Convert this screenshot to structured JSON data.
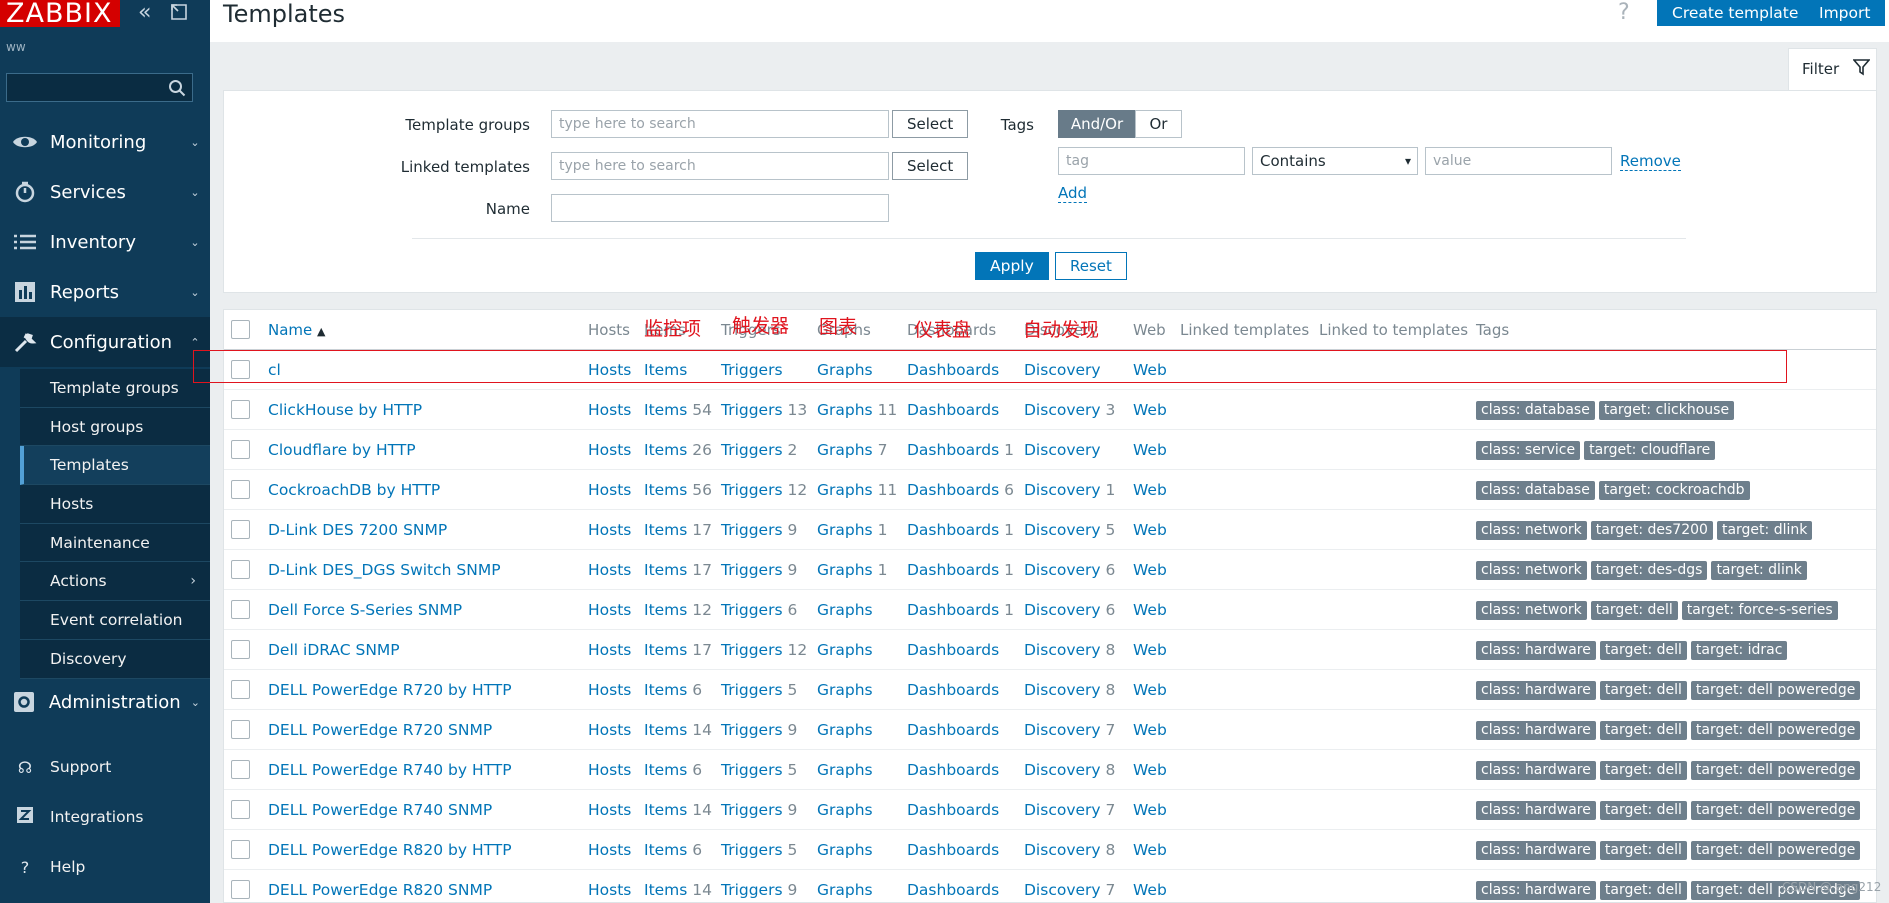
{
  "app": {
    "logo": "ZABBIX",
    "user": "ww"
  },
  "sidebar": {
    "main": [
      {
        "label": "Monitoring"
      },
      {
        "label": "Services"
      },
      {
        "label": "Inventory"
      },
      {
        "label": "Reports"
      },
      {
        "label": "Configuration"
      }
    ],
    "config_items": [
      {
        "label": "Template groups"
      },
      {
        "label": "Host groups"
      },
      {
        "label": "Templates"
      },
      {
        "label": "Hosts"
      },
      {
        "label": "Maintenance"
      },
      {
        "label": "Actions"
      },
      {
        "label": "Event correlation"
      },
      {
        "label": "Discovery"
      }
    ],
    "administration": "Administration",
    "bottom": [
      {
        "label": "Support"
      },
      {
        "label": "Integrations"
      },
      {
        "label": "Help"
      }
    ]
  },
  "header": {
    "title": "Templates",
    "help": "?",
    "create_button": "Create template",
    "import_button": "Import"
  },
  "filter": {
    "tab_label": "Filter",
    "template_groups_label": "Template groups",
    "template_groups_placeholder": "type here to search",
    "linked_templates_label": "Linked templates",
    "linked_templates_placeholder": "type here to search",
    "select_label": "Select",
    "name_label": "Name",
    "name_value": "",
    "tags_label": "Tags",
    "andor_label": "And/Or",
    "or_label": "Or",
    "tag_placeholder": "tag",
    "operator": "Contains",
    "value_placeholder": "value",
    "remove_label": "Remove",
    "add_label": "Add",
    "apply_label": "Apply",
    "reset_label": "Reset"
  },
  "table": {
    "headers": {
      "name": "Name",
      "sort_indicator": "▲",
      "hosts": "Hosts",
      "items": "Items",
      "triggers": "Triggers",
      "graphs": "Graphs",
      "dashboards": "Dashboards",
      "discovery": "Discovery",
      "web": "Web",
      "linked_templates": "Linked templates",
      "linked_to_templates": "Linked to templates",
      "tags": "Tags"
    },
    "rows": [
      {
        "name": "cl",
        "hosts": "Hosts",
        "items": "Items",
        "items_count": "",
        "triggers": "Triggers",
        "triggers_count": "",
        "graphs": "Graphs",
        "graphs_count": "",
        "dashboards": "Dashboards",
        "dashboards_count": "",
        "discovery": "Discovery",
        "discovery_count": "",
        "web": "Web",
        "tags": []
      },
      {
        "name": "ClickHouse by HTTP",
        "hosts": "Hosts",
        "items": "Items",
        "items_count": "54",
        "triggers": "Triggers",
        "triggers_count": "13",
        "graphs": "Graphs",
        "graphs_count": "11",
        "dashboards": "Dashboards",
        "dashboards_count": "",
        "discovery": "Discovery",
        "discovery_count": "3",
        "web": "Web",
        "tags": [
          "class: database",
          "target: clickhouse"
        ]
      },
      {
        "name": "Cloudflare by HTTP",
        "hosts": "Hosts",
        "items": "Items",
        "items_count": "26",
        "triggers": "Triggers",
        "triggers_count": "2",
        "graphs": "Graphs",
        "graphs_count": "7",
        "dashboards": "Dashboards",
        "dashboards_count": "1",
        "discovery": "Discovery",
        "discovery_count": "",
        "web": "Web",
        "tags": [
          "class: service",
          "target: cloudflare"
        ]
      },
      {
        "name": "CockroachDB by HTTP",
        "hosts": "Hosts",
        "items": "Items",
        "items_count": "56",
        "triggers": "Triggers",
        "triggers_count": "12",
        "graphs": "Graphs",
        "graphs_count": "11",
        "dashboards": "Dashboards",
        "dashboards_count": "6",
        "discovery": "Discovery",
        "discovery_count": "1",
        "web": "Web",
        "tags": [
          "class: database",
          "target: cockroachdb"
        ]
      },
      {
        "name": "D-Link DES 7200 SNMP",
        "hosts": "Hosts",
        "items": "Items",
        "items_count": "17",
        "triggers": "Triggers",
        "triggers_count": "9",
        "graphs": "Graphs",
        "graphs_count": "1",
        "dashboards": "Dashboards",
        "dashboards_count": "1",
        "discovery": "Discovery",
        "discovery_count": "5",
        "web": "Web",
        "tags": [
          "class: network",
          "target: des7200",
          "target: dlink"
        ]
      },
      {
        "name": "D-Link DES_DGS Switch SNMP",
        "hosts": "Hosts",
        "items": "Items",
        "items_count": "17",
        "triggers": "Triggers",
        "triggers_count": "9",
        "graphs": "Graphs",
        "graphs_count": "1",
        "dashboards": "Dashboards",
        "dashboards_count": "1",
        "discovery": "Discovery",
        "discovery_count": "6",
        "web": "Web",
        "tags": [
          "class: network",
          "target: des-dgs",
          "target: dlink"
        ]
      },
      {
        "name": "Dell Force S-Series SNMP",
        "hosts": "Hosts",
        "items": "Items",
        "items_count": "12",
        "triggers": "Triggers",
        "triggers_count": "6",
        "graphs": "Graphs",
        "graphs_count": "",
        "dashboards": "Dashboards",
        "dashboards_count": "1",
        "discovery": "Discovery",
        "discovery_count": "6",
        "web": "Web",
        "tags": [
          "class: network",
          "target: dell",
          "target: force-s-series"
        ]
      },
      {
        "name": "Dell iDRAC SNMP",
        "hosts": "Hosts",
        "items": "Items",
        "items_count": "17",
        "triggers": "Triggers",
        "triggers_count": "12",
        "graphs": "Graphs",
        "graphs_count": "",
        "dashboards": "Dashboards",
        "dashboards_count": "",
        "discovery": "Discovery",
        "discovery_count": "8",
        "web": "Web",
        "tags": [
          "class: hardware",
          "target: dell",
          "target: idrac"
        ]
      },
      {
        "name": "DELL PowerEdge R720 by HTTP",
        "hosts": "Hosts",
        "items": "Items",
        "items_count": "6",
        "triggers": "Triggers",
        "triggers_count": "5",
        "graphs": "Graphs",
        "graphs_count": "",
        "dashboards": "Dashboards",
        "dashboards_count": "",
        "discovery": "Discovery",
        "discovery_count": "8",
        "web": "Web",
        "tags": [
          "class: hardware",
          "target: dell",
          "target: dell poweredge"
        ]
      },
      {
        "name": "DELL PowerEdge R720 SNMP",
        "hosts": "Hosts",
        "items": "Items",
        "items_count": "14",
        "triggers": "Triggers",
        "triggers_count": "9",
        "graphs": "Graphs",
        "graphs_count": "",
        "dashboards": "Dashboards",
        "dashboards_count": "",
        "discovery": "Discovery",
        "discovery_count": "7",
        "web": "Web",
        "tags": [
          "class: hardware",
          "target: dell",
          "target: dell poweredge"
        ]
      },
      {
        "name": "DELL PowerEdge R740 by HTTP",
        "hosts": "Hosts",
        "items": "Items",
        "items_count": "6",
        "triggers": "Triggers",
        "triggers_count": "5",
        "graphs": "Graphs",
        "graphs_count": "",
        "dashboards": "Dashboards",
        "dashboards_count": "",
        "discovery": "Discovery",
        "discovery_count": "8",
        "web": "Web",
        "tags": [
          "class: hardware",
          "target: dell",
          "target: dell poweredge"
        ]
      },
      {
        "name": "DELL PowerEdge R740 SNMP",
        "hosts": "Hosts",
        "items": "Items",
        "items_count": "14",
        "triggers": "Triggers",
        "triggers_count": "9",
        "graphs": "Graphs",
        "graphs_count": "",
        "dashboards": "Dashboards",
        "dashboards_count": "",
        "discovery": "Discovery",
        "discovery_count": "7",
        "web": "Web",
        "tags": [
          "class: hardware",
          "target: dell",
          "target: dell poweredge"
        ]
      },
      {
        "name": "DELL PowerEdge R820 by HTTP",
        "hosts": "Hosts",
        "items": "Items",
        "items_count": "6",
        "triggers": "Triggers",
        "triggers_count": "5",
        "graphs": "Graphs",
        "graphs_count": "",
        "dashboards": "Dashboards",
        "dashboards_count": "",
        "discovery": "Discovery",
        "discovery_count": "8",
        "web": "Web",
        "tags": [
          "class: hardware",
          "target: dell",
          "target: dell poweredge"
        ]
      },
      {
        "name": "DELL PowerEdge R820 SNMP",
        "hosts": "Hosts",
        "items": "Items",
        "items_count": "14",
        "triggers": "Triggers",
        "triggers_count": "9",
        "graphs": "Graphs",
        "graphs_count": "",
        "dashboards": "Dashboards",
        "dashboards_count": "",
        "discovery": "Discovery",
        "discovery_count": "7",
        "web": "Web",
        "tags": [
          "class: hardware",
          "target: dell",
          "target: dell poweredge"
        ]
      }
    ]
  },
  "annotations": {
    "items": "监控项",
    "triggers": "触发器",
    "graphs": "图表",
    "dashboards": "仪表盘",
    "discovery": "自动发现"
  },
  "watermark": "CSDN @ ang212",
  "colors": {
    "sidebar": "#0f3b58",
    "primary": "#0275b8",
    "logo": "#d40000",
    "tag": "#6e7f8c",
    "annotation": "#e0141e"
  }
}
